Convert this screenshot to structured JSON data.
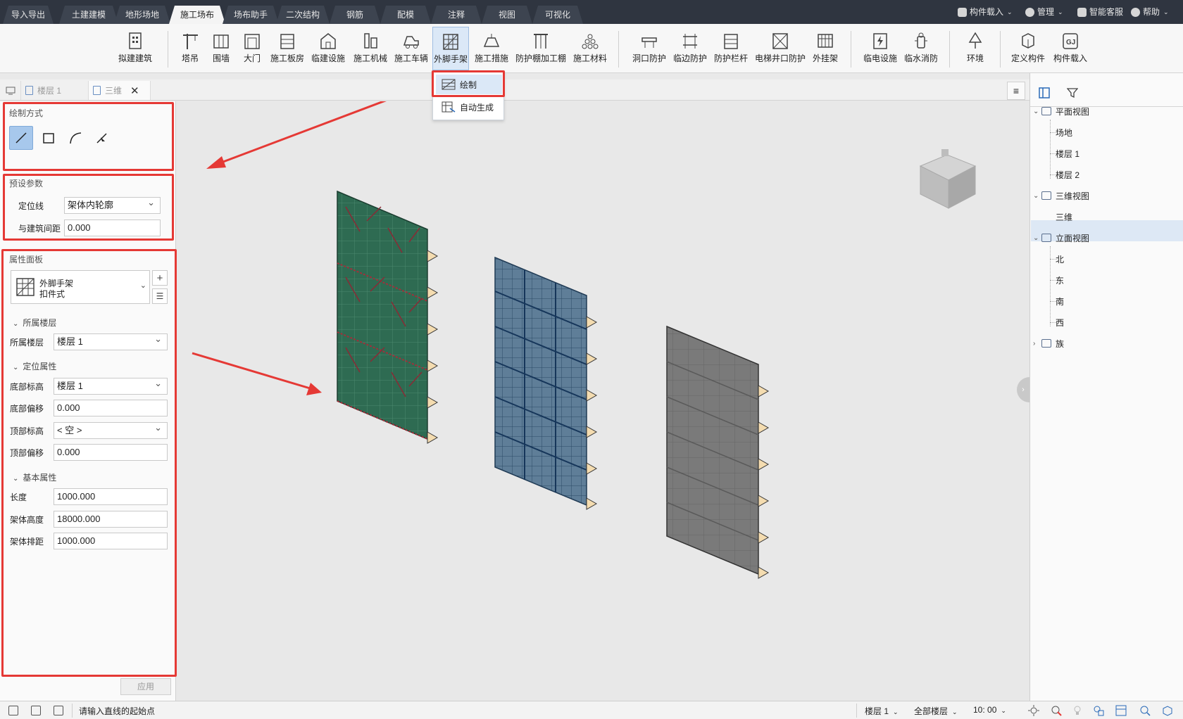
{
  "menu_tabs": [
    {
      "label": "导入导出"
    },
    {
      "label": "土建建模"
    },
    {
      "label": "地形场地"
    },
    {
      "label": "施工场布"
    },
    {
      "label": "场布助手"
    },
    {
      "label": "二次结构"
    },
    {
      "label": "钢筋"
    },
    {
      "label": "配模"
    },
    {
      "label": "注释"
    },
    {
      "label": "视图"
    },
    {
      "label": "可视化"
    }
  ],
  "active_menu_tab": "施工场布",
  "top_right": {
    "component_load": "构件载入",
    "manage": "管理",
    "customer_service": "智能客服",
    "help": "帮助"
  },
  "ribbon": [
    {
      "label": "拟建建筑"
    },
    {
      "label": "塔吊"
    },
    {
      "label": "围墙"
    },
    {
      "label": "大门"
    },
    {
      "label": "施工板房"
    },
    {
      "label": "临建设施"
    },
    {
      "label": "施工机械"
    },
    {
      "label": "施工车辆"
    },
    {
      "label": "外脚手架"
    },
    {
      "label": "施工措施"
    },
    {
      "label": "防护棚加工棚"
    },
    {
      "label": "施工材料"
    },
    {
      "label": "洞口防护"
    },
    {
      "label": "临边防护"
    },
    {
      "label": "防护栏杆"
    },
    {
      "label": "电梯井口防护"
    },
    {
      "label": "外挂架"
    },
    {
      "label": "临电设施"
    },
    {
      "label": "临水消防"
    },
    {
      "label": "环境"
    },
    {
      "label": "定义构件"
    },
    {
      "label": "构件载入"
    }
  ],
  "dropdown": {
    "draw": "绘制",
    "auto_generate": "自动生成"
  },
  "doc_tabs": {
    "floor1": "楼层 1",
    "view3d": "三维"
  },
  "left_panel": {
    "draw_mode_title": "绘制方式",
    "preset_title": "预设参数",
    "locate_line_label": "定位线",
    "locate_line_value": "架体内轮廓",
    "distance_label": "与建筑间距",
    "distance_value": "0.000",
    "property_title": "属性面板",
    "type_name": "外脚手架",
    "type_sub": "扣件式",
    "group_floor": "所属楼层",
    "floor_label": "所属楼层",
    "floor_value": "楼层 1",
    "group_position": "定位属性",
    "bottom_elev_label": "底部标高",
    "bottom_elev_value": "楼层 1",
    "bottom_offset_label": "底部偏移",
    "bottom_offset_value": "0.000",
    "top_elev_label": "顶部标高",
    "top_elev_value": "< 空 >",
    "top_offset_label": "顶部偏移",
    "top_offset_value": "0.000",
    "group_basic": "基本属性",
    "length_label": "长度",
    "length_value": "1000.000",
    "height_label": "架体高度",
    "height_value": "18000.000",
    "spacing_label": "架体排距",
    "spacing_value": "1000.000",
    "apply": "应用"
  },
  "tree": {
    "plan_view": "平面视图",
    "site": "场地",
    "floor1": "楼层 1",
    "floor2": "楼层 2",
    "view3d_group": "三维视图",
    "view3d": "三维",
    "elevation_view": "立面视图",
    "north": "北",
    "east": "东",
    "south": "南",
    "west": "西",
    "family": "族"
  },
  "status": {
    "prompt": "请输入直线的起始点",
    "floor": "楼层 1",
    "all_floors": "全部楼层",
    "time": "10: 00"
  },
  "colors": {
    "accent": "#a7c8ec",
    "highlight_red": "#e53935",
    "menubar": "#2f3540",
    "panel_green": "#2e6b52",
    "panel_blue": "#5f7e98",
    "panel_gray": "#7a7a7a"
  }
}
